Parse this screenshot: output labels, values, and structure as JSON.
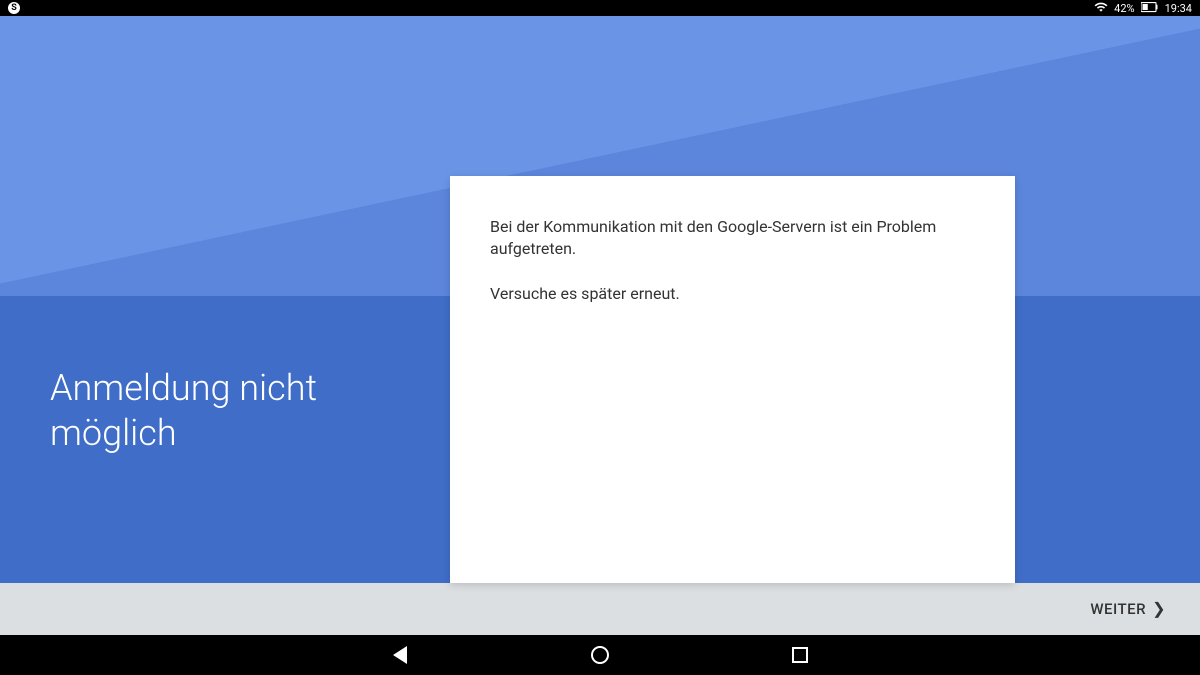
{
  "status_bar": {
    "battery_percent": "42%",
    "time": "19:34"
  },
  "main": {
    "title": "Anmeldung nicht möglich",
    "error_message": "Bei der Kommunikation mit den Google-Servern ist ein Problem aufgetreten.",
    "retry_message": "Versuche es später erneut."
  },
  "action_bar": {
    "next_label": "WEITER"
  }
}
